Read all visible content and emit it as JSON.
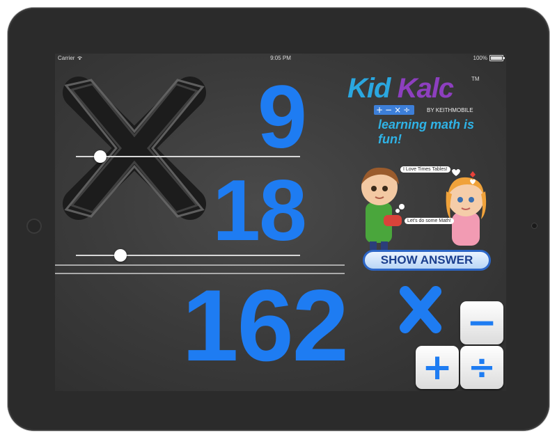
{
  "status_bar": {
    "carrier": "Carrier",
    "time": "9:05 PM",
    "battery": "100%"
  },
  "problem": {
    "operator_symbol": "×",
    "top_number": "9",
    "second_number": "18",
    "answer": "162",
    "top_slider_value": 0.11,
    "second_slider_value": 0.2
  },
  "logo": {
    "title_part1": "Kid",
    "title_part2": "Kalc",
    "trademark": "TM",
    "operators": "+−×÷",
    "byline": "BY KEITHMOBILE",
    "tagline": "learning math is fun!"
  },
  "kids": {
    "speech_girl": "I Love Times Tables!",
    "speech_boy": "Let's do some Math!"
  },
  "show_answer_label": "SHOW ANSWER",
  "operators": {
    "minus": "−",
    "plus": "+",
    "divide": "÷"
  },
  "colors": {
    "number_blue": "#1e7cf2",
    "chalkboard": "#3b3b3b"
  }
}
